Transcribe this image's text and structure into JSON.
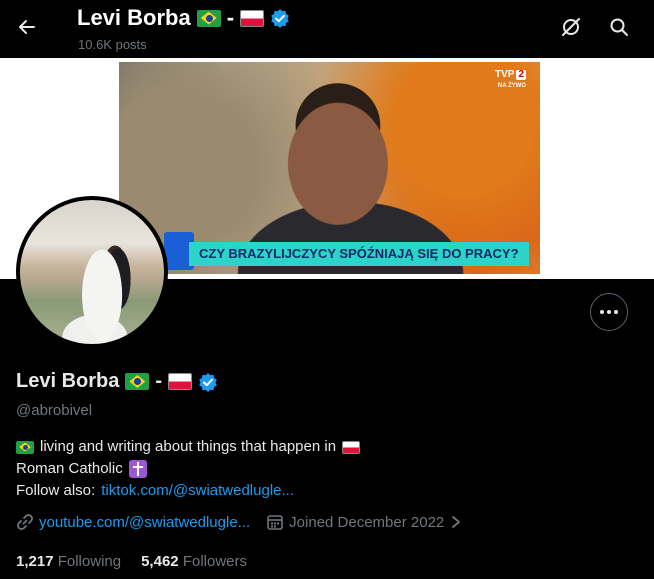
{
  "header": {
    "name": "Levi Borba",
    "separator": "-",
    "posts_count": "10.6K posts"
  },
  "banner": {
    "tv_channel": "TVP 2",
    "tv_channel_number": "2",
    "tv_live": "NA ŻYWO",
    "caption": "CZY BRAZYLIJCZYCY SPÓŹNIAJĄ SIĘ DO PRACY?"
  },
  "profile": {
    "name": "Levi Borba",
    "separator": "-",
    "handle": "@abrobivel",
    "bio_line1": "living and writing about things that happen in",
    "bio_line2": "Roman Catholic",
    "bio_line3_prefix": "Follow also:",
    "bio_line3_link": "tiktok.com/@swiatwedlugle...",
    "website": "youtube.com/@swiatwedlugle...",
    "joined": "Joined December 2022",
    "following_count": "1,217",
    "following_label": "Following",
    "followers_count": "5,462",
    "followers_label": "Followers"
  },
  "colors": {
    "background": "#000000",
    "text": "#e7e9ea",
    "muted": "#71767b",
    "link": "#1d9bf0",
    "verified": "#1d9bf0"
  },
  "icons": [
    "back-arrow-icon",
    "grok-icon",
    "search-icon",
    "more-icon",
    "verified-badge-icon",
    "link-icon",
    "calendar-icon",
    "chevron-right-icon"
  ]
}
